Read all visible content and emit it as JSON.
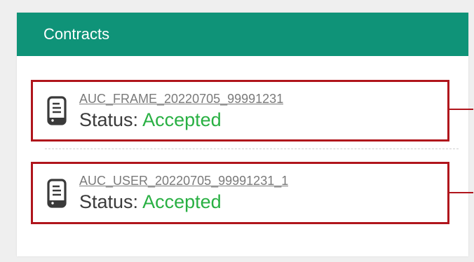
{
  "panel": {
    "title": "Contracts",
    "header_color": "#0f9378"
  },
  "contracts": [
    {
      "name": "AUC_FRAME_20220705_99991231",
      "status_label": "Status:",
      "status_value": "Accepted",
      "icon": "document-icon"
    },
    {
      "name": "AUC_USER_20220705_99991231_1",
      "status_label": "Status:",
      "status_value": "Accepted",
      "icon": "document-icon"
    }
  ],
  "colors": {
    "status_accepted": "#29b043",
    "highlight_border": "#b0151c"
  }
}
